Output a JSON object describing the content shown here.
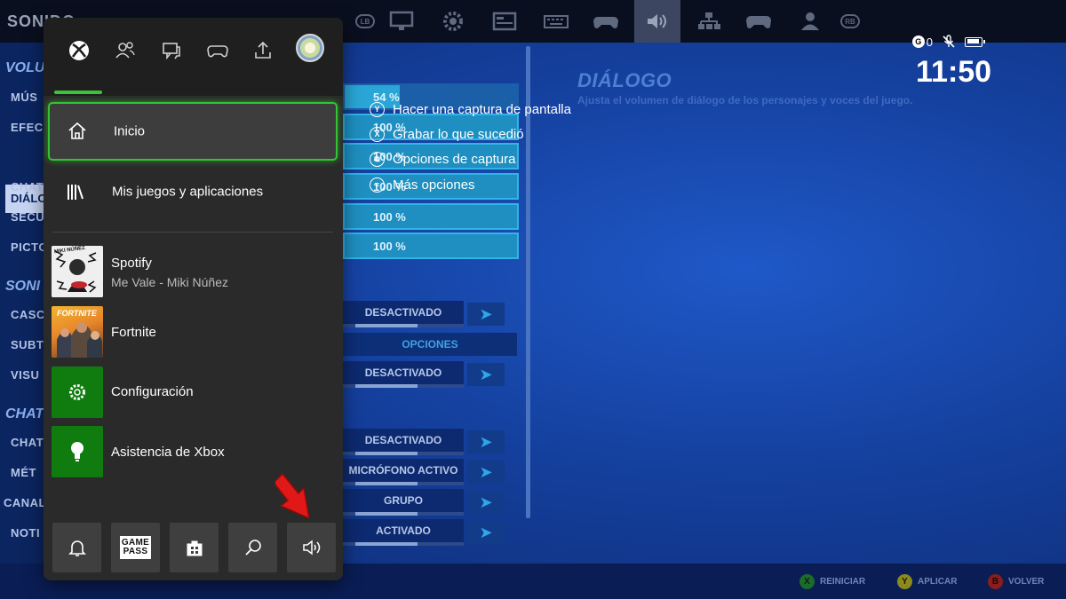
{
  "game": {
    "top_title": "SONIDO",
    "bumper_left": "LB",
    "bumper_right": "RB",
    "left_nav": {
      "section_volumes": "VOLU",
      "items_volumes": [
        "MÚS",
        "EFEC",
        "DIÁLO",
        "CHAT",
        "SECU",
        "PICTO"
      ],
      "section_sound": "SONI",
      "items_sound": [
        "CASC",
        "SUBT",
        "VISU"
      ],
      "section_chat": "CHAT",
      "items_chat": [
        "CHAT",
        "MÉT",
        "CANAL",
        "NOTI"
      ]
    },
    "volume_values": [
      "54 %",
      "100 %",
      "100 %",
      "100 %",
      "100 %",
      "100 %"
    ],
    "options": {
      "row1": "DESACTIVADO",
      "row2": "OPCIONES",
      "row3": "DESACTIVADO",
      "row4": "DESACTIVADO",
      "row5": "MICRÓFONO ACTIVO",
      "row6": "GRUPO",
      "row7": "ACTIVADO"
    },
    "detail": {
      "title": "DIÁLOGO",
      "description": "Ajusta el volumen de diálogo de los personajes y voces del juego."
    },
    "footer": {
      "reset_key": "X",
      "reset_label": "REINICIAR",
      "apply_key": "Y",
      "apply_label": "APLICAR",
      "back_key": "B",
      "back_label": "VOLVER"
    }
  },
  "capture_menu": [
    {
      "glyph": "Y",
      "label": "Hacer una captura de pantalla"
    },
    {
      "glyph": "X",
      "label": "Grabar lo que sucedió"
    },
    {
      "glyph": "⧉",
      "label": "Opciones de captura"
    },
    {
      "glyph": "≡",
      "label": "Más opciones"
    }
  ],
  "status": {
    "gamerscore_badge": "G",
    "gamerscore_value": "0",
    "mic_icon": "mic-muted-icon",
    "battery_icon": "battery-icon",
    "clock": "11:50"
  },
  "guide": {
    "tabs": [
      "xbox-icon",
      "people-icon",
      "chat-icon",
      "controller-icon",
      "share-icon",
      "avatar"
    ],
    "home_label": "Inicio",
    "my_games_label": "Mis juegos y aplicaciones",
    "recents": [
      {
        "title": "Spotify",
        "subtitle": "Me Vale - Miki Núñez"
      },
      {
        "title": "Fortnite"
      },
      {
        "title": "Configuración"
      },
      {
        "title": "Asistencia de Xbox"
      }
    ],
    "spotify_art_text": "MIKI NÚÑEZ",
    "fortnite_art_text": "FORTNITE",
    "gamepass_line1": "GAME",
    "gamepass_line2": "PASS",
    "quick_buttons": [
      "bell-icon",
      "game-pass-icon",
      "store-icon",
      "search-icon",
      "volume-icon"
    ],
    "accent": "#33c433"
  }
}
